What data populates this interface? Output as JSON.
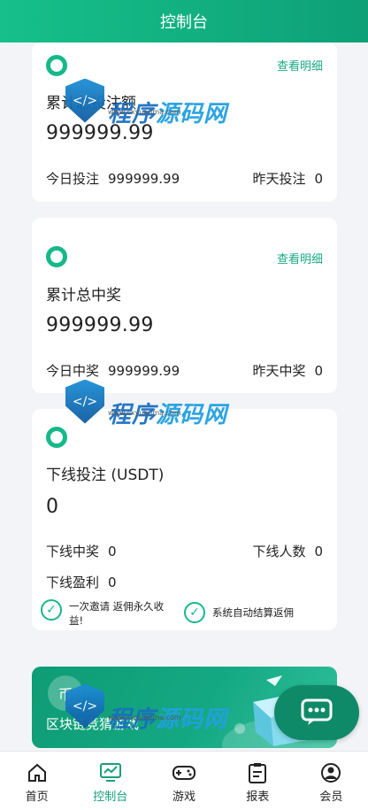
{
  "header": {
    "title": "控制台"
  },
  "cards": [
    {
      "detail": "查看明细",
      "title": "累计总投注额",
      "total": "999999.99",
      "left_label": "今日投注",
      "left_value": "999999.99",
      "right_label": "昨天投注",
      "right_value": "0"
    },
    {
      "detail": "查看明细",
      "title": "累计总中奖",
      "total": "999999.99",
      "left_label": "今日中奖",
      "left_value": "999999.99",
      "right_label": "昨天中奖",
      "right_value": "0"
    }
  ],
  "downline": {
    "title": "下线投注 (USDT)",
    "total": "0",
    "win_label": "下线中奖",
    "win_value": "0",
    "people_label": "下线人数",
    "people_value": "0",
    "profit_label": "下线盈利",
    "profit_value": "0",
    "check1": "一次邀请 返佣永久收益!",
    "check2": "系统自动结算返佣"
  },
  "banner": {
    "title": "区块链竞猜游戏"
  },
  "watermark": {
    "text_a": "程序",
    "text_b": "源码网",
    "url": "www.cxyuanma.com"
  },
  "tabs": [
    {
      "label": "首页",
      "icon": "home-icon"
    },
    {
      "label": "控制台",
      "icon": "dashboard-icon"
    },
    {
      "label": "游戏",
      "icon": "gamepad-icon"
    },
    {
      "label": "报表",
      "icon": "report-icon"
    },
    {
      "label": "会员",
      "icon": "user-icon"
    }
  ],
  "colors": {
    "accent": "#16b88a",
    "header": "#14b886",
    "background": "#f3f4f8"
  }
}
